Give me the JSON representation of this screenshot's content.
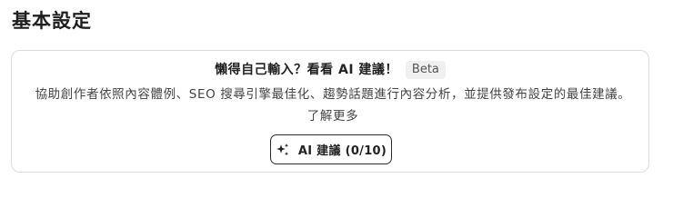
{
  "section": {
    "title": "基本設定"
  },
  "ai_card": {
    "headline": "懶得自己輸入？看看 AI 建議！",
    "badge": "Beta",
    "description": "協助創作者依照內容體例、SEO 搜尋引擎最佳化、趨勢話題進行內容分析，並提供發布設定的最佳建議。了解更多",
    "button": {
      "icon": "sparkle-icon",
      "label": "AI 建議 (0/10)"
    }
  },
  "colors": {
    "border": "#dcdcdc",
    "button_border": "#2a2a2a",
    "badge_bg": "#f0f0f0",
    "text": "#222222"
  }
}
